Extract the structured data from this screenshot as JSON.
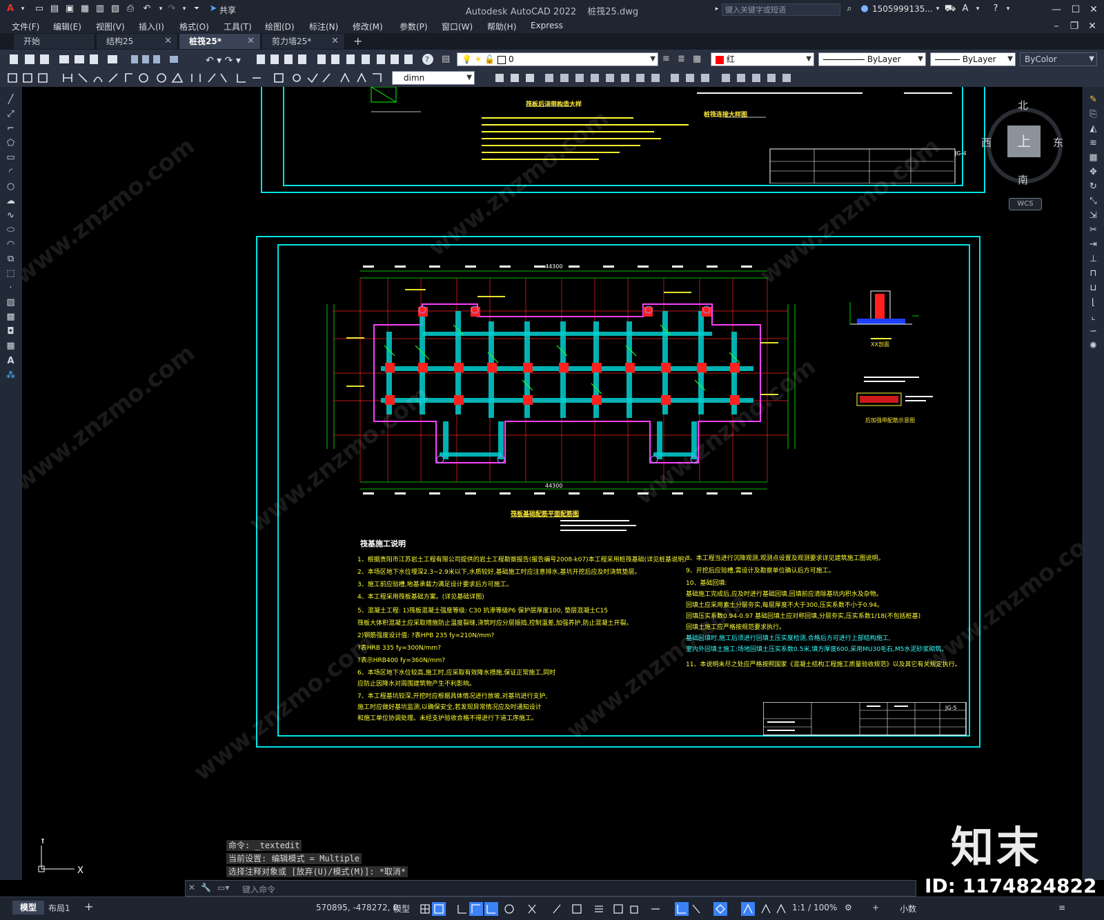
{
  "titlebar": {
    "app_title": "Autodesk AutoCAD 2022",
    "file_name": "桩筏25.dwg",
    "share_label": "共享",
    "search_placeholder": "键入关键字或短语",
    "user_name": "1505999135..."
  },
  "menu": [
    "文件(F)",
    "编辑(E)",
    "视图(V)",
    "插入(I)",
    "格式(O)",
    "工具(T)",
    "绘图(D)",
    "标注(N)",
    "修改(M)",
    "参数(P)",
    "窗口(W)",
    "帮助(H)",
    "Express"
  ],
  "tabs": [
    {
      "label": "开始"
    },
    {
      "label": "结构25"
    },
    {
      "label": "桩筏25*"
    },
    {
      "label": "剪力墙25*"
    }
  ],
  "properties": {
    "layer": "0",
    "color": "红",
    "linetype": "ByLayer",
    "lineweight": "ByLayer",
    "plotstyle": "ByColor",
    "dimstyle": "dimn",
    "color_hex": "#ff0000"
  },
  "viewcube": {
    "north": "北",
    "south": "南",
    "east": "东",
    "west": "西",
    "face": "上",
    "wcs": "WCS"
  },
  "drawing": {
    "upper_title_1": "筏板后浇带构造大样",
    "upper_title_2": "桩筏连接大样图",
    "plan_title": "筏板基础配筋平面配筋图",
    "section_title_1": "XX剖面",
    "section_title_2": "后加强带配筋示意图",
    "dim_top": "44300",
    "dim_bottom": "44300",
    "notes_title": "筏基施工说明",
    "notes_left": [
      "1、根据贵阳市江苏岩土工程有限公司提供的岩土工程勘察报告(报告编号2008-k07)本工程采用桩筏基础(详见桩基说明)",
      "2、本场区地下水位埋深2.3~2.9米以下,水质较好,基础施工时应注意排水,基坑开挖后应及时浇筑垫层。",
      "3、施工前应验槽,地基承载力满足设计要求后方可施工。",
      "4、本工程采用筏板基础方案。(详见基础详图)",
      "5、混凝土工程: 1)筏板混凝土强度等级: C30 抗渗等级P6 保护层厚度100, 垫层混凝土C15",
      "      筏板大体积混凝土应采取措施防止温度裂缝,浇筑时应分层振捣,控制温差,加强养护,防止混凝土开裂。",
      "   2)钢筋强度设计值: ?表HPB 235  fy=210N/mm?",
      "                      ?表HRB 335  fy=300N/mm?",
      "                      ?表示HRB400 fy=360N/mm?",
      "6、本场区地下水位较高,施工时,应采取有效降水措施,保证正常施工,同时",
      "   应防止因降水对周围建筑物产生不利影响。",
      "7、本工程基坑较深,开挖时应根据具体情况进行放坡,对基坑进行支护,",
      "   施工时应做好基坑监测,以确保安全,若发现异常情况应及时通知设计",
      "   和施工单位协调处理。未经支护验收合格不得进行下道工序施工。"
    ],
    "notes_right": [
      "8、本工程当进行沉降观测,观测点设置及观测要求详见建筑施工图说明。",
      "9、开挖后应验槽,需设计及勘察单位确认后方可施工。",
      "10、基础回填:",
      "    基础施工完成后,应及时进行基础回填,回填前应清除基坑内积水及杂物。",
      "    回填土应采用素土分层夯实,每层厚度不大于300,压实系数不小于0.94。",
      "    回填压实系数0.94-0.97 基础回填土应对称回填,分层夯实,压实系数1/18(不包括桩基)",
      "    回填土施工应严格按规范要求执行。",
      "    基础回填时,施工后须进行回填土压实度检测,合格后方可进行上部结构施工,",
      "    室内外回填土施工:场地回填土压实系数0.5米,填方厚度600,采用MU30毛石,M5水泥砂浆砌筑。",
      "11、本说明未尽之处应严格按照国家《混凝土结构工程施工质量验收规范》以及其它有关规定执行。"
    ],
    "title_block_code_upper": "JG-4",
    "title_block_code_lower": "JG-5"
  },
  "command": {
    "history": [
      "命令: _textedit",
      "当前设置: 编辑模式 = Multiple",
      "选择注释对象或 [放弃(U)/模式(M)]: *取消*"
    ],
    "input_placeholder": "键入命令"
  },
  "status": {
    "model_tab": "模型",
    "layout_tab": "布局1",
    "coords": "570895, -478272, 0",
    "space": "模型",
    "scale": "1:1 / 100%",
    "units": "小数"
  },
  "watermark": {
    "brand": "知末",
    "site": "www.znzmo.com",
    "id_label": "ID: 1174824822"
  }
}
